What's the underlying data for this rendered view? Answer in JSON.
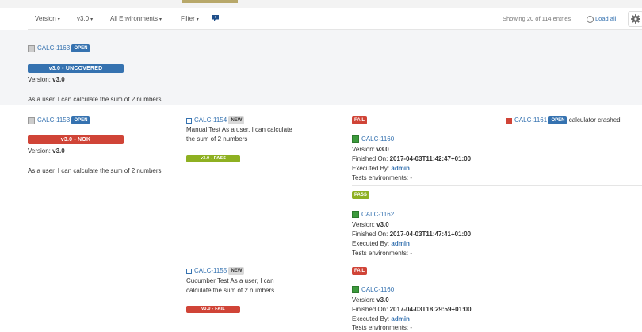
{
  "toolbar": {
    "version_label": "Version",
    "version_value": "v3.0",
    "environments": "All Environments",
    "filter": "Filter",
    "showing": "Showing 20 of 114 entries",
    "load_all": "Load all"
  },
  "colors": {
    "blue": "#3572b0",
    "red": "#d04437",
    "green": "#8eb021"
  },
  "sections": [
    {
      "key": "CALC-1163",
      "status": "OPEN",
      "coverage": "v3.0 - UNCOVERED",
      "version_label": "Version:",
      "version": "v3.0",
      "summary": "As a user, I can calculate the sum of 2 numbers"
    },
    {
      "key": "CALC-1153",
      "status": "OPEN",
      "coverage": "v3.0 - NOK",
      "version_label": "Version:",
      "version": "v3.0",
      "summary": "As a user, I can calculate the sum of 2 numbers",
      "tests": [
        {
          "key": "CALC-1154",
          "status": "NEW",
          "summary_line1": "Manual Test As a user, I can calculate",
          "summary_line2": "the sum of 2 numbers",
          "result_bar": "v3.0 - PASS",
          "executions": [
            {
              "result": "FAIL",
              "key": "CALC-1160",
              "version_label": "Version:",
              "version": "v3.0",
              "finished_label": "Finished On:",
              "finished": "2017-04-03T11:42:47+01:00",
              "executed_label": "Executed By:",
              "executed_by": "admin",
              "env_label": "Tests environments:",
              "env": "-",
              "defect": {
                "key": "CALC-1161",
                "status": "OPEN",
                "summary": "calculator crashed"
              }
            },
            {
              "result": "PASS",
              "key": "CALC-1162",
              "version_label": "Version:",
              "version": "v3.0",
              "finished_label": "Finished On:",
              "finished": "2017-04-03T11:47:41+01:00",
              "executed_label": "Executed By:",
              "executed_by": "admin",
              "env_label": "Tests environments:",
              "env": "-"
            }
          ]
        },
        {
          "key": "CALC-1155",
          "status": "NEW",
          "summary_line1": "Cucumber Test As a user, I can",
          "summary_line2": "calculate the sum of 2 numbers",
          "result_bar": "v3.0 - FAIL",
          "executions": [
            {
              "result": "FAIL",
              "key": "CALC-1160",
              "version_label": "Version:",
              "version": "v3.0",
              "finished_label": "Finished On:",
              "finished": "2017-04-03T18:29:59+01:00",
              "executed_label": "Executed By:",
              "executed_by": "admin",
              "env_label": "Tests environments:",
              "env": "-"
            }
          ]
        }
      ]
    }
  ]
}
